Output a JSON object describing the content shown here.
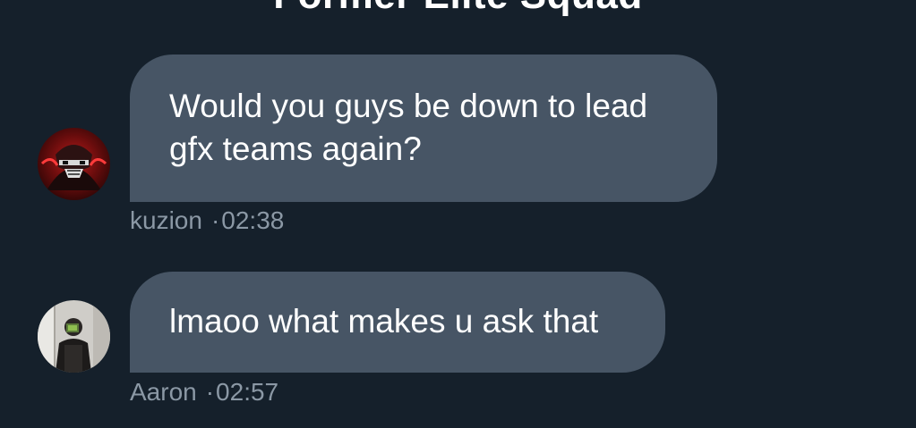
{
  "conversation": {
    "title": "Former Elite Squad"
  },
  "messages": [
    {
      "author": "kuzion",
      "time": "02:38",
      "text_lines": [
        "Would you guys be down to lead",
        "gfx teams again?"
      ],
      "avatar_icon": "masked-character-avatar"
    },
    {
      "author": "Aaron",
      "time": "02:57",
      "text_lines": [
        "lmaoo what makes u ask that"
      ],
      "avatar_icon": "mirror-selfie-avatar"
    }
  ],
  "separator": "·",
  "colors": {
    "background": "#15202b",
    "bubble": "#475565",
    "meta_text": "#8b98a5",
    "text": "#ffffff"
  }
}
